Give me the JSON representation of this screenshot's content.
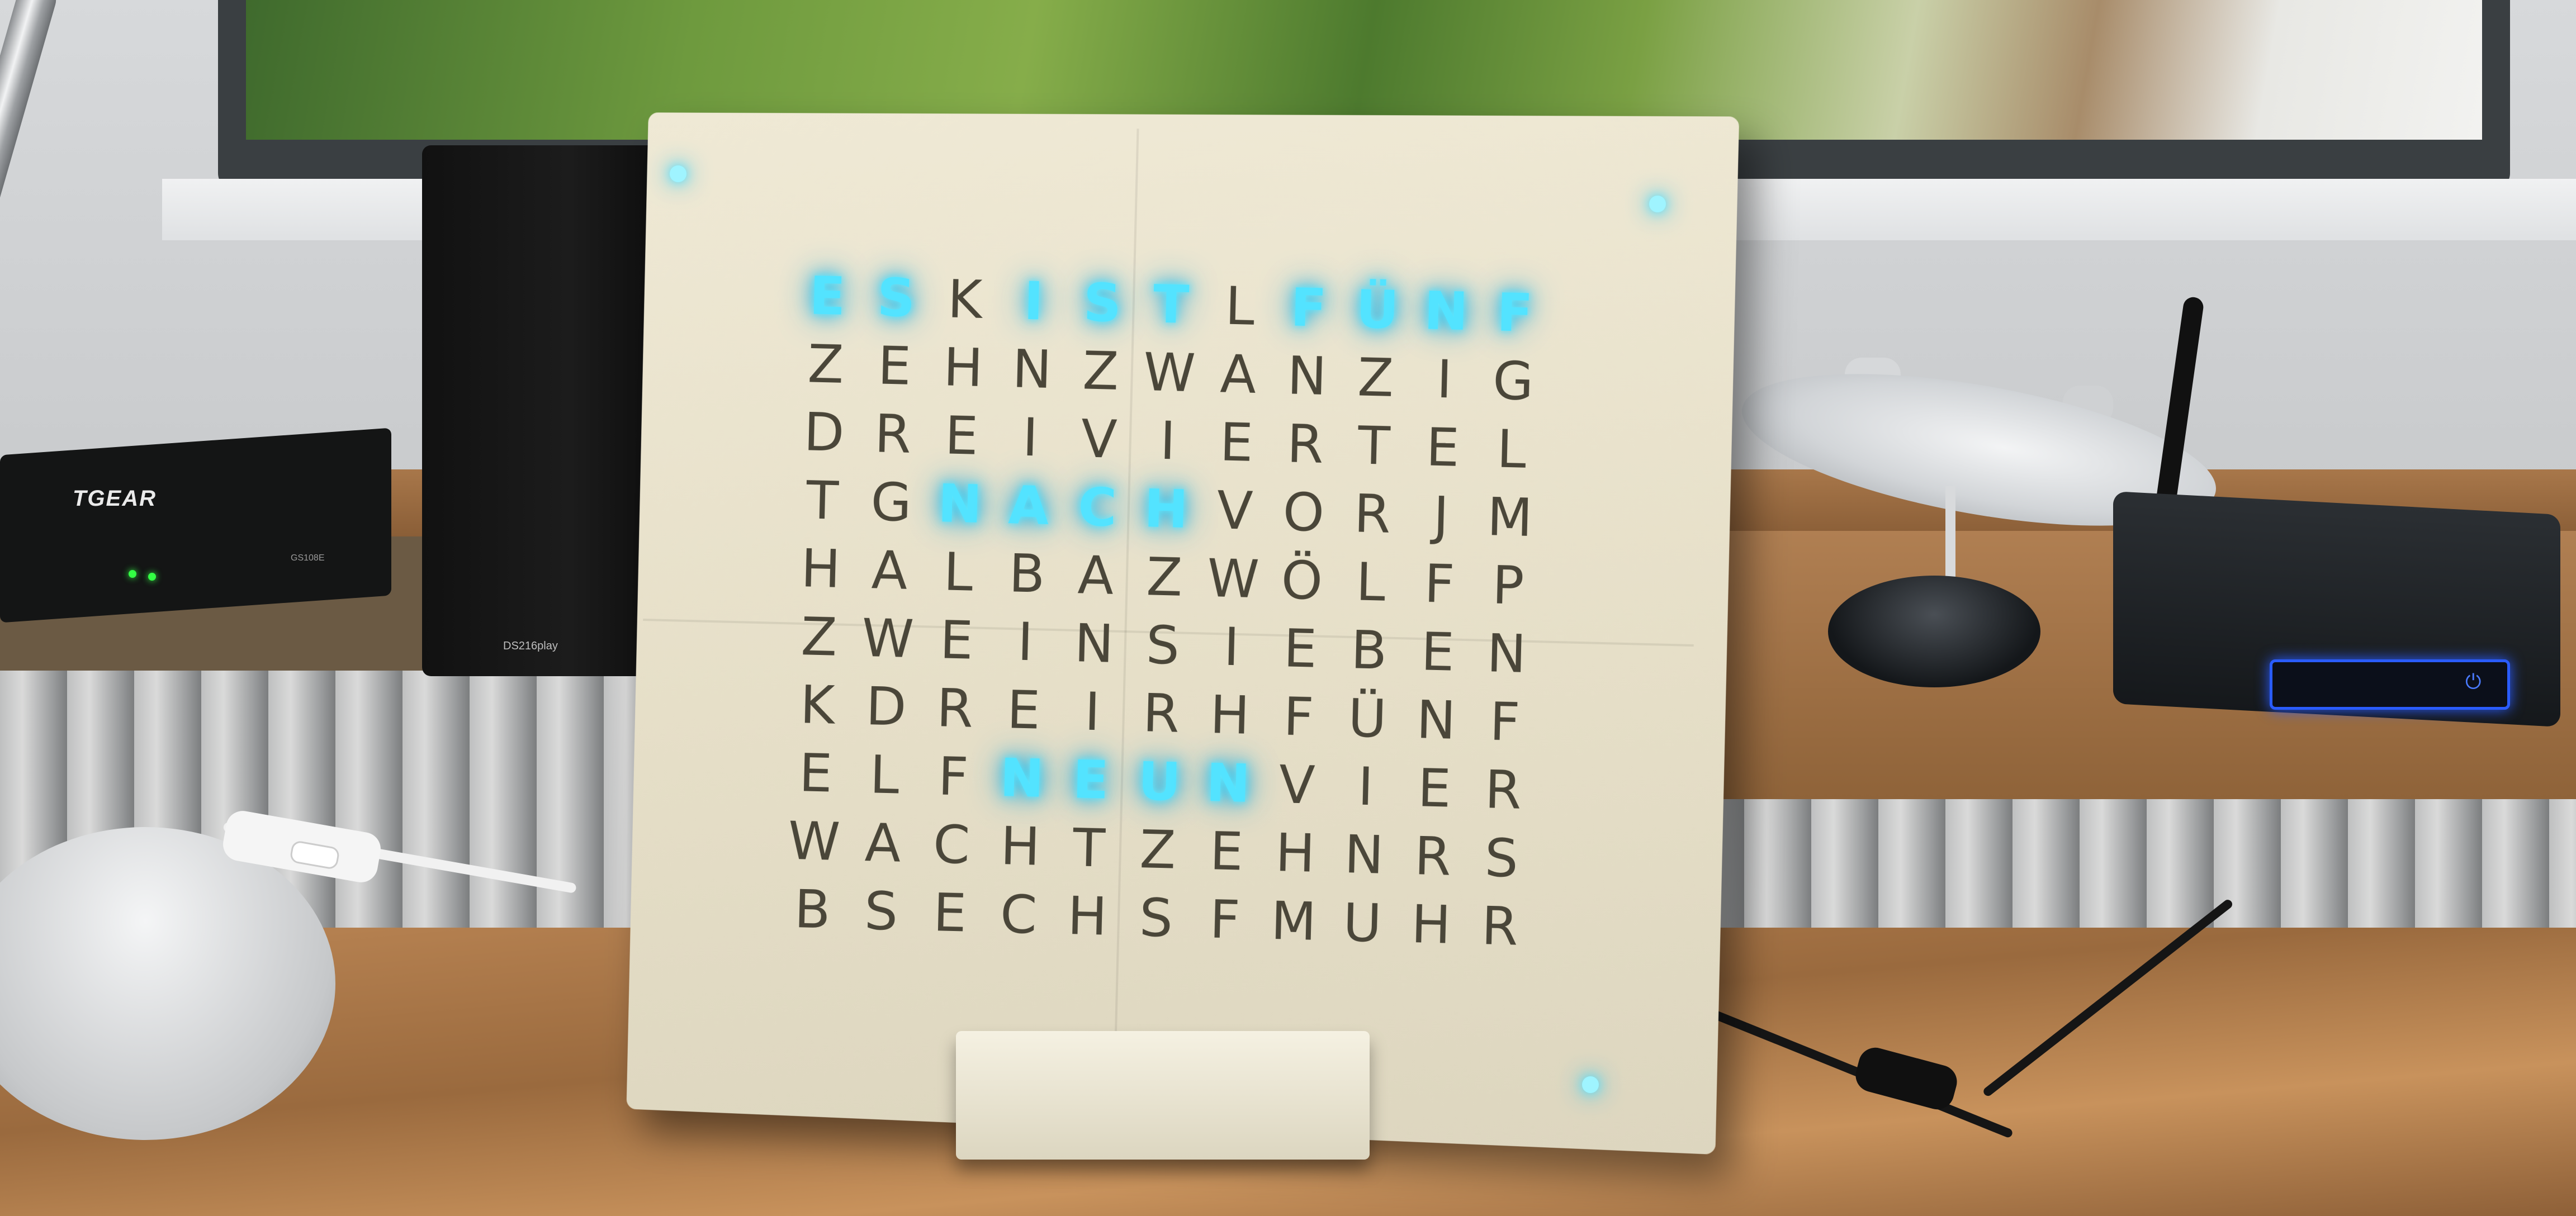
{
  "scene": {
    "switch_brand": "TGEAR",
    "switch_model": "GS108E",
    "nas_label": "DS216play",
    "pc_power_symbol": "⏻"
  },
  "word_clock": {
    "lit_color": "#53e3ff",
    "unlit_color": "#4a4639",
    "rows": [
      {
        "letters": [
          "E",
          "S",
          "K",
          "I",
          "S",
          "T",
          "L",
          "F",
          "Ü",
          "N",
          "F"
        ],
        "lit": [
          1,
          1,
          0,
          1,
          1,
          1,
          0,
          1,
          1,
          1,
          1
        ]
      },
      {
        "letters": [
          "Z",
          "E",
          "H",
          "N",
          "Z",
          "W",
          "A",
          "N",
          "Z",
          "I",
          "G"
        ],
        "lit": [
          0,
          0,
          0,
          0,
          0,
          0,
          0,
          0,
          0,
          0,
          0
        ]
      },
      {
        "letters": [
          "D",
          "R",
          "E",
          "I",
          "V",
          "I",
          "E",
          "R",
          "T",
          "E",
          "L"
        ],
        "lit": [
          0,
          0,
          0,
          0,
          0,
          0,
          0,
          0,
          0,
          0,
          0
        ]
      },
      {
        "letters": [
          "T",
          "G",
          "N",
          "A",
          "C",
          "H",
          "V",
          "O",
          "R",
          "J",
          "M"
        ],
        "lit": [
          0,
          0,
          1,
          1,
          1,
          1,
          0,
          0,
          0,
          0,
          0
        ]
      },
      {
        "letters": [
          "H",
          "A",
          "L",
          "B",
          "A",
          "Z",
          "W",
          "Ö",
          "L",
          "F",
          "P"
        ],
        "lit": [
          0,
          0,
          0,
          0,
          0,
          0,
          0,
          0,
          0,
          0,
          0
        ]
      },
      {
        "letters": [
          "Z",
          "W",
          "E",
          "I",
          "N",
          "S",
          "I",
          "E",
          "B",
          "E",
          "N"
        ],
        "lit": [
          0,
          0,
          0,
          0,
          0,
          0,
          0,
          0,
          0,
          0,
          0
        ]
      },
      {
        "letters": [
          "K",
          "D",
          "R",
          "E",
          "I",
          "R",
          "H",
          "F",
          "Ü",
          "N",
          "F"
        ],
        "lit": [
          0,
          0,
          0,
          0,
          0,
          0,
          0,
          0,
          0,
          0,
          0
        ]
      },
      {
        "letters": [
          "E",
          "L",
          "F",
          "N",
          "E",
          "U",
          "N",
          "V",
          "I",
          "E",
          "R"
        ],
        "lit": [
          0,
          0,
          0,
          1,
          1,
          1,
          1,
          0,
          0,
          0,
          0
        ]
      },
      {
        "letters": [
          "W",
          "A",
          "C",
          "H",
          "T",
          "Z",
          "E",
          "H",
          "N",
          "R",
          "S"
        ],
        "lit": [
          0,
          0,
          0,
          0,
          0,
          0,
          0,
          0,
          0,
          0,
          0
        ]
      },
      {
        "letters": [
          "B",
          "S",
          "E",
          "C",
          "H",
          "S",
          "F",
          "M",
          "U",
          "H",
          "R"
        ],
        "lit": [
          0,
          0,
          0,
          0,
          0,
          0,
          0,
          0,
          0,
          0,
          0
        ]
      }
    ]
  }
}
